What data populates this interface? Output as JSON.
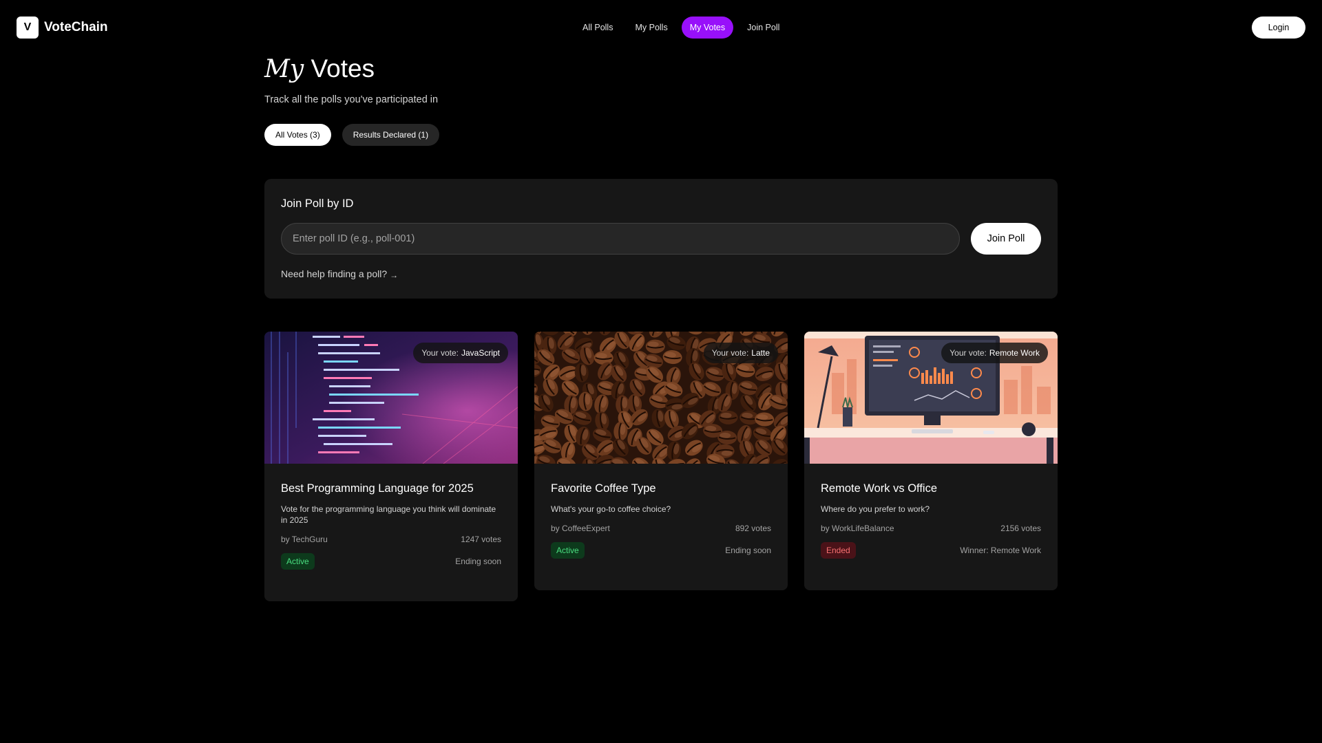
{
  "app": {
    "logo_letter": "V",
    "name": "VoteChain"
  },
  "nav": {
    "items": [
      {
        "label": "All Polls",
        "active": false
      },
      {
        "label": "My Polls",
        "active": false
      },
      {
        "label": "My Votes",
        "active": true
      },
      {
        "label": "Join Poll",
        "active": false
      }
    ],
    "login_label": "Login"
  },
  "page": {
    "title_emphasis": "My",
    "title_rest": "Votes",
    "subtitle": "Track all the polls you've participated in"
  },
  "filters": [
    {
      "label": "All Votes (3)",
      "active": true
    },
    {
      "label": "Results Declared (1)",
      "active": false
    }
  ],
  "join": {
    "title": "Join Poll by ID",
    "placeholder": "Enter poll ID (e.g., poll-001)",
    "value": "",
    "button_label": "Join Poll",
    "help_text": "Need help finding a poll?",
    "help_arrow": "→"
  },
  "cards": [
    {
      "image": "code-screen-image",
      "vote_prefix": "Your vote:",
      "vote_value": "JavaScript",
      "title": "Best Programming Language for 2025",
      "description": "Vote for the programming language you think will dominate in 2025",
      "author": "by TechGuru",
      "votes": "1247 votes",
      "status": "Active",
      "footer_note": "Ending soon"
    },
    {
      "image": "coffee-beans-image",
      "vote_prefix": "Your vote:",
      "vote_value": "Latte",
      "title": "Favorite Coffee Type",
      "description": "What's your go-to coffee choice?",
      "author": "by CoffeeExpert",
      "votes": "892 votes",
      "status": "Active",
      "footer_note": "Ending soon"
    },
    {
      "image": "home-office-desk-image",
      "vote_prefix": "Your vote:",
      "vote_value": "Remote Work",
      "title": "Remote Work vs Office",
      "description": "Where do you prefer to work?",
      "author": "by WorkLifeBalance",
      "votes": "2156 votes",
      "status": "Ended",
      "footer_note": "Winner: Remote Work"
    }
  ],
  "colors": {
    "accent": "#9810fa",
    "background": "#000000",
    "panel": "#171717",
    "status_active": "#4ade80",
    "status_ended": "#f87171"
  }
}
